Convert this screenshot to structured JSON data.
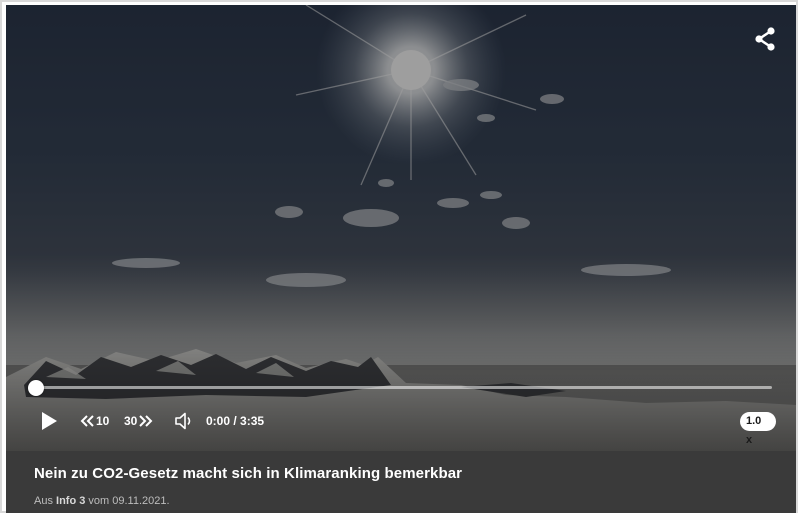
{
  "player": {
    "controls": {
      "rewind_label": "10",
      "forward_label": "30",
      "time_current": "0:00",
      "time_separator": " / ",
      "time_total": "3:35",
      "speed_label": "1.0 x"
    },
    "progress_fraction": 0.0,
    "icons": [
      "share-icon",
      "play-icon",
      "rewind-icon",
      "forward-icon",
      "volume-icon"
    ]
  },
  "video": {
    "title": "Nein zu CO2-Gesetz macht sich in Klimaranking bemerkbar",
    "source_prefix": "Aus ",
    "source_link": "Info 3",
    "source_suffix": " vom 09.11.2021."
  }
}
